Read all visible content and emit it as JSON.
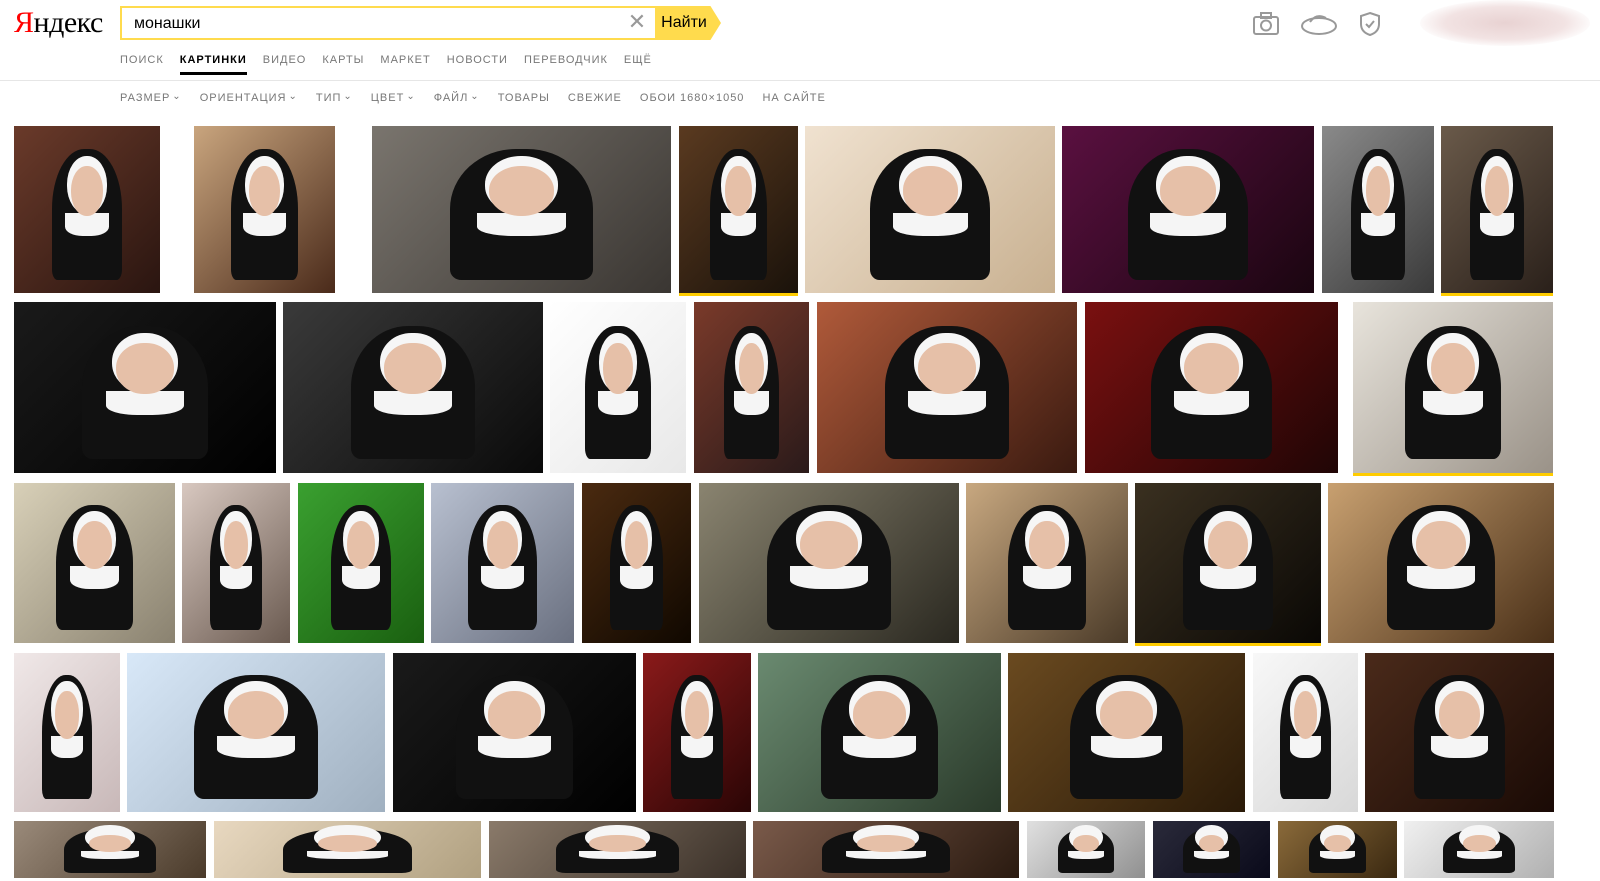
{
  "header": {
    "logo_first": "Я",
    "logo_rest": "ндекс",
    "search_value": "монашки",
    "find_button": "Найти",
    "nav": [
      "ПОИСК",
      "КАРТИНКИ",
      "ВИДЕО",
      "КАРТЫ",
      "МАРКЕТ",
      "НОВОСТИ",
      "ПЕРЕВОДЧИК",
      "ЕЩЁ"
    ],
    "nav_active": "КАРТИНКИ",
    "icons": [
      "camera-icon",
      "cloud-icon",
      "shield-icon"
    ]
  },
  "filters": [
    {
      "label": "РАЗМЕР",
      "dropdown": true
    },
    {
      "label": "ОРИЕНТАЦИЯ",
      "dropdown": true
    },
    {
      "label": "ТИП",
      "dropdown": true
    },
    {
      "label": "ЦВЕТ",
      "dropdown": true
    },
    {
      "label": "ФАЙЛ",
      "dropdown": true
    },
    {
      "label": "ТОВАРЫ",
      "dropdown": false
    },
    {
      "label": "СВЕЖИЕ",
      "dropdown": false
    },
    {
      "label": "ОБОИ 1680×1050",
      "dropdown": false
    },
    {
      "label": "НА САЙТЕ",
      "dropdown": false
    }
  ],
  "results": [
    {
      "tiles": [
        {
          "c1": "#6a3a2a",
          "c2": "#2a1510"
        },
        {
          "c1": "#c9a57e",
          "c2": "#4a2a1a"
        },
        {
          "c1": "#7a756e",
          "c2": "#3a3632"
        },
        {
          "c1": "#5a3a20",
          "c2": "#1a120a",
          "sel": true
        },
        {
          "c1": "#f0e2d0",
          "c2": "#c8b090"
        },
        {
          "c1": "#5a1040",
          "c2": "#1a0510"
        },
        {
          "c1": "#8a8a8a",
          "c2": "#3a3a3a"
        },
        {
          "c1": "#6a5a4a",
          "c2": "#2a201a",
          "sel": true
        }
      ]
    },
    {
      "tiles": [
        {
          "c1": "#1a1a1a",
          "c2": "#000000"
        },
        {
          "c1": "#3a3a3a",
          "c2": "#0a0a0a"
        },
        {
          "c1": "#ffffff",
          "c2": "#e8e8e8"
        },
        {
          "c1": "#7a3a2a",
          "c2": "#2a1a1a"
        },
        {
          "c1": "#b05a3a",
          "c2": "#3a1a10"
        },
        {
          "c1": "#7a1010",
          "c2": "#200505"
        },
        {
          "c1": "#e8e4dc",
          "c2": "#9a9288",
          "sel": true
        }
      ]
    },
    {
      "tiles": [
        {
          "c1": "#d8d0b8",
          "c2": "#8a8270"
        },
        {
          "c1": "#d8c8c0",
          "c2": "#6a5a50"
        },
        {
          "c1": "#3aa030",
          "c2": "#1a6010"
        },
        {
          "c1": "#b8c0d0",
          "c2": "#6a7080"
        },
        {
          "c1": "#4a2a10",
          "c2": "#100800"
        },
        {
          "c1": "#8a8470",
          "c2": "#2a2820"
        },
        {
          "c1": "#c8a880",
          "c2": "#4a3a28"
        },
        {
          "c1": "#3a3020",
          "c2": "#0a0805",
          "sel": true
        },
        {
          "c1": "#c8a070",
          "c2": "#4a3018"
        }
      ]
    },
    {
      "tiles": [
        {
          "c1": "#f0e8e8",
          "c2": "#c8b8b8"
        },
        {
          "c1": "#d8e8f8",
          "c2": "#a0b0c0"
        },
        {
          "c1": "#1a1a1a",
          "c2": "#000000"
        },
        {
          "c1": "#8a1a1a",
          "c2": "#2a0505"
        },
        {
          "c1": "#6a8a70",
          "c2": "#2a3a2a"
        },
        {
          "c1": "#6a4a20",
          "c2": "#2a1a08"
        },
        {
          "c1": "#f8f8f8",
          "c2": "#d8d8d8"
        },
        {
          "c1": "#4a2a1a",
          "c2": "#1a0a05"
        }
      ]
    },
    {
      "tiles": [
        {
          "c1": "#9a8a7a",
          "c2": "#4a3a2a"
        },
        {
          "c1": "#e8d8c0",
          "c2": "#b0a080"
        },
        {
          "c1": "#8a7a6a",
          "c2": "#3a3028"
        },
        {
          "c1": "#7a5a4a",
          "c2": "#2a1a10"
        },
        {
          "c1": "#e0e0e0",
          "c2": "#909090"
        },
        {
          "c1": "#2a2a3a",
          "c2": "#0a0a1a"
        },
        {
          "c1": "#8a6a3a",
          "c2": "#3a2810"
        },
        {
          "c1": "#f0f0f0",
          "c2": "#b0b0b0"
        }
      ]
    }
  ]
}
